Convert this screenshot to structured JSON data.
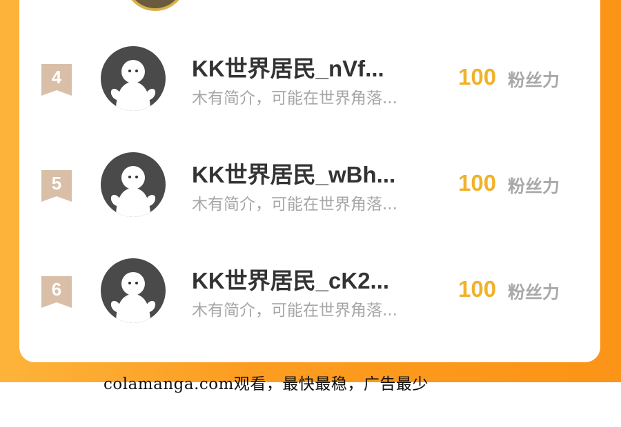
{
  "ranking": {
    "entries": [
      {
        "rank": "4",
        "username": "KK世界居民_nVf...",
        "bio": "木有简介，可能在世界角落...",
        "fans_value": "100",
        "fans_unit": "粉丝力",
        "avatar_icon": "default-avatar-icon"
      },
      {
        "rank": "5",
        "username": "KK世界居民_wBh...",
        "bio": "木有简介，可能在世界角落...",
        "fans_value": "100",
        "fans_unit": "粉丝力",
        "avatar_icon": "default-avatar-icon"
      },
      {
        "rank": "6",
        "username": "KK世界居民_cK2...",
        "bio": "木有简介，可能在世界角落...",
        "fans_value": "100",
        "fans_unit": "粉丝力",
        "avatar_icon": "default-avatar-icon"
      }
    ]
  },
  "footer": {
    "watermark_text": "colamanga.com观看，最快最稳，广告最少"
  },
  "colors": {
    "accent_orange": "#fb9417",
    "fans_value_gold": "#f0b22c",
    "rank_badge": "#d9bfa7",
    "avatar_dark": "#4a4a4a"
  }
}
